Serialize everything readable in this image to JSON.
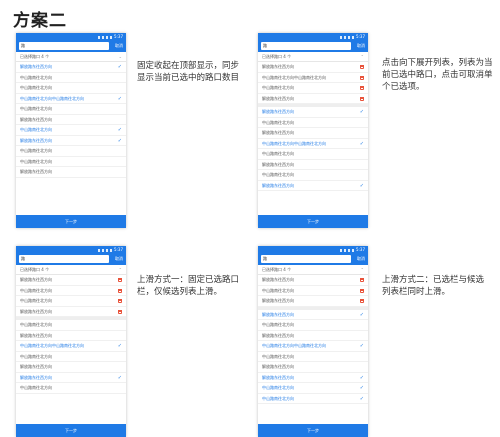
{
  "page": {
    "title": "方案二"
  },
  "status_time": "5:37",
  "search_value": "路",
  "cancel_label": "取消",
  "next_label": "下一步",
  "selected_header": "已选择路口 4 个",
  "screens": [
    {
      "description": "固定收起在顶部显示，同步显示当前已选中的路口数目",
      "show_selected": false,
      "list": [
        {
          "text": "解放路东往西方向",
          "selected": true
        },
        {
          "text": "中山路南往北方向",
          "selected": false
        },
        {
          "text": "中山路南往北方向",
          "selected": false
        },
        {
          "text": "中山路南往北方向中山路南往北方向",
          "selected": true
        },
        {
          "text": "中山路南往北方向",
          "selected": false
        },
        {
          "text": "解放路东往西方向",
          "selected": false
        },
        {
          "text": "中山路南往北方向",
          "selected": true
        },
        {
          "text": "解放路东往西方向",
          "selected": true
        },
        {
          "text": "中山路南往北方向",
          "selected": false
        },
        {
          "text": "中山路南往北方向",
          "selected": false
        },
        {
          "text": "解放路东往西方向",
          "selected": false
        }
      ]
    },
    {
      "description": "点击向下展开列表，列表为当前已选中路口，点击可取消单个已选项。",
      "show_selected": true,
      "selected": [
        "解放路东往西方向",
        "中山路南往北方向中山路南往北方向",
        "中山路南往北方向",
        "解放路东往西方向"
      ],
      "list": [
        {
          "text": "解放路东往西方向",
          "selected": true
        },
        {
          "text": "中山路南往北方向",
          "selected": false
        },
        {
          "text": "解放路东往西方向",
          "selected": false
        },
        {
          "text": "中山路南往北方向中山路南往北方向",
          "selected": true
        },
        {
          "text": "中山路南往北方向",
          "selected": false
        },
        {
          "text": "解放路东往西方向",
          "selected": false
        },
        {
          "text": "中山路南往北方向",
          "selected": false
        },
        {
          "text": "解放路东往西方向",
          "selected": true
        }
      ]
    },
    {
      "description": "上滑方式一：固定已选路口栏，仅候选列表上滑。",
      "show_selected": true,
      "selected": [
        "解放路东往西方向",
        "中山路南往北方向",
        "中山路南往北方向",
        "解放路东往西方向"
      ],
      "list": [
        {
          "text": "中山路南往北方向",
          "selected": false
        },
        {
          "text": "解放路东往西方向",
          "selected": false
        },
        {
          "text": "中山路南往北方向中山路南往北方向",
          "selected": true
        },
        {
          "text": "中山路南往北方向",
          "selected": false
        },
        {
          "text": "解放路东往西方向",
          "selected": false
        },
        {
          "text": "解放路东往西方向",
          "selected": true
        },
        {
          "text": "中山路南往北方向",
          "selected": false
        }
      ]
    },
    {
      "description": "上滑方式二：已选栏与候选列表栏同时上滑。",
      "show_selected": true,
      "selected": [
        "解放路东往西方向",
        "中山路南往北方向",
        "解放路东往西方向"
      ],
      "list": [
        {
          "text": "解放路东往西方向",
          "selected": true
        },
        {
          "text": "中山路南往北方向",
          "selected": false
        },
        {
          "text": "解放路东往西方向",
          "selected": false
        },
        {
          "text": "中山路南往北方向中山路南往北方向",
          "selected": true
        },
        {
          "text": "中山路南往北方向",
          "selected": false
        },
        {
          "text": "解放路东往西方向",
          "selected": false
        },
        {
          "text": "解放路东往西方向",
          "selected": true
        },
        {
          "text": "中山路南往北方向",
          "selected": true
        },
        {
          "text": "中山路南往北方向",
          "selected": true
        }
      ]
    }
  ]
}
